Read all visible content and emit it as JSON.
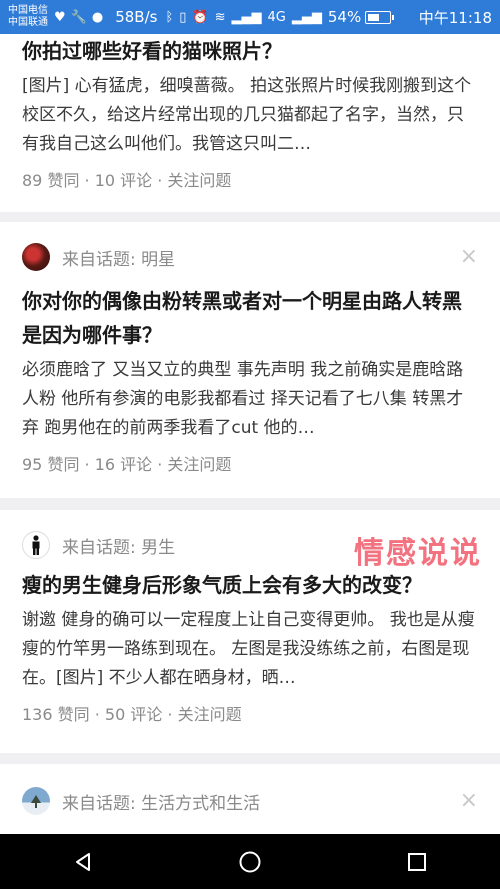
{
  "status_bar": {
    "carrier_top": "中国电信",
    "carrier_bottom": "中国联通",
    "speed": "58B/s",
    "battery_pct": "54%",
    "time": "中午11:18",
    "network_label": "4G"
  },
  "feed": [
    {
      "title": "你拍过哪些好看的猫咪照片？",
      "excerpt": "[图片] 心有猛虎，细嗅蔷薇。 拍这张照片时候我刚搬到这个校区不久，给这片经常出现的几只猫都起了名字，当然，只有我自己这么叫他们。我管这只叫二…",
      "meta": "89 赞同 · 10 评论 · 关注问题"
    },
    {
      "topic": "来自话题: 明星",
      "title": "你对你的偶像由粉转黑或者对一个明星由路人转黑是因为哪件事？",
      "excerpt": "必须鹿晗了 又当又立的典型 事先声明 我之前确实是鹿晗路人粉 他所有参演的电影我都看过 择天记看了七八集 转黑才弃 跑男他在的前两季我看了cut 他的…",
      "meta": "95 赞同 · 16 评论 · 关注问题",
      "close": "×"
    },
    {
      "topic": "来自话题: 男生",
      "title": "瘦的男生健身后形象气质上会有多大的改变？",
      "excerpt": "谢邀 健身的确可以一定程度上让自己变得更帅。 我也是从瘦瘦的竹竿男一路练到现在。 左图是我没练练之前，右图是现在。[图片] 不少人都在晒身材，晒…",
      "meta": "136 赞同 · 50 评论 · 关注问题"
    },
    {
      "topic": "来自话题: 生活方式和生活",
      "close": "×"
    }
  ],
  "watermark": "情感说说",
  "nav_icons": [
    "back-icon",
    "home-icon",
    "recents-icon"
  ],
  "colors": {
    "status_bar": "#2f7bd8",
    "watermark": "#f05a6a"
  }
}
